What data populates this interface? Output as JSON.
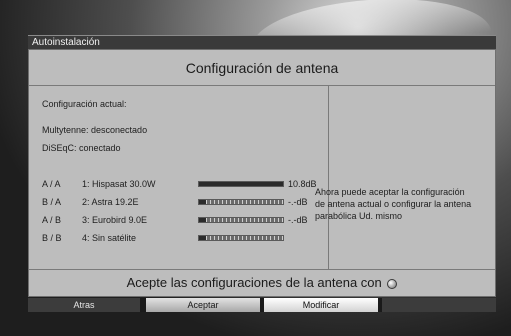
{
  "window": {
    "title": "Autoinstalación"
  },
  "header": {
    "title": "Configuración de antena"
  },
  "left": {
    "current_label": "Configuración actual:",
    "multytenne": "Multytenne: desconectado",
    "diseqc": "DiSEqC: conectado",
    "satellites": [
      {
        "position": "A / A",
        "name": "1:  Hispasat 30.0W",
        "signal": "10.8dB",
        "level": 1.0
      },
      {
        "position": "B / A",
        "name": "2:  Astra 19.2E",
        "signal": "-.-dB",
        "level": 0.08
      },
      {
        "position": "A / B",
        "name": "3:  Eurobird 9.0E",
        "signal": "-.-dB",
        "level": 0.08
      },
      {
        "position": "B / B",
        "name": "4:  Sin satélite",
        "signal": "",
        "level": 0.08
      }
    ]
  },
  "right": {
    "info_text": "Ahora puede aceptar la configuración de antena actual o configurar la antena parabólica Ud. mismo"
  },
  "footer": {
    "prompt": "Acepte las configuraciones de la antena con",
    "icon": "ok-button-icon"
  },
  "buttons": {
    "back": "Atras",
    "accept": "Aceptar",
    "modify": "Modificar"
  }
}
